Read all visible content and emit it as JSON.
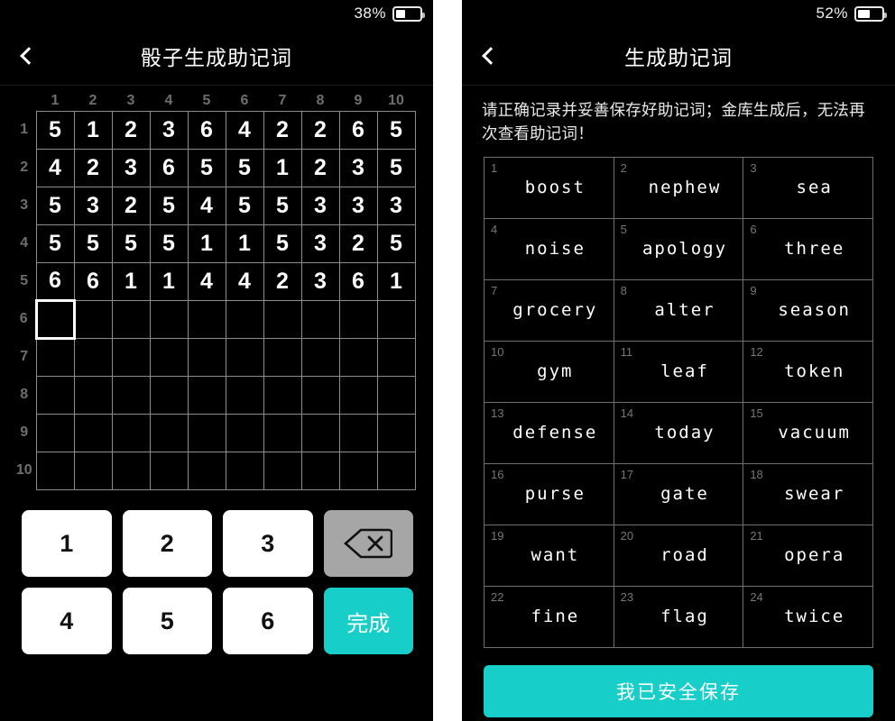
{
  "left_panel": {
    "status": {
      "battery_percent": "38%",
      "battery_level": 38
    },
    "header": {
      "back_icon": "chevron-left-icon",
      "title": "骰子生成助记词"
    },
    "dice_grid": {
      "column_headers": [
        "1",
        "2",
        "3",
        "4",
        "5",
        "6",
        "7",
        "8",
        "9",
        "10"
      ],
      "row_headers": [
        "1",
        "2",
        "3",
        "4",
        "5",
        "6",
        "7",
        "8",
        "9",
        "10"
      ],
      "rows": [
        [
          "5",
          "1",
          "2",
          "3",
          "6",
          "4",
          "2",
          "2",
          "6",
          "5"
        ],
        [
          "4",
          "2",
          "3",
          "6",
          "5",
          "5",
          "1",
          "2",
          "3",
          "5"
        ],
        [
          "5",
          "3",
          "2",
          "5",
          "4",
          "5",
          "5",
          "3",
          "3",
          "3"
        ],
        [
          "5",
          "5",
          "5",
          "5",
          "1",
          "1",
          "5",
          "3",
          "2",
          "5"
        ],
        [
          "6",
          "6",
          "1",
          "1",
          "4",
          "4",
          "2",
          "3",
          "6",
          "1"
        ],
        [
          "",
          "",
          "",
          "",
          "",
          "",
          "",
          "",
          "",
          ""
        ],
        [
          "",
          "",
          "",
          "",
          "",
          "",
          "",
          "",
          "",
          ""
        ],
        [
          "",
          "",
          "",
          "",
          "",
          "",
          "",
          "",
          "",
          ""
        ],
        [
          "",
          "",
          "",
          "",
          "",
          "",
          "",
          "",
          "",
          ""
        ],
        [
          "",
          "",
          "",
          "",
          "",
          "",
          "",
          "",
          "",
          ""
        ]
      ],
      "active_cell": {
        "row": 6,
        "col": 1
      }
    },
    "keypad": {
      "keys": [
        {
          "label": "1",
          "kind": "digit",
          "name": "key-1"
        },
        {
          "label": "2",
          "kind": "digit",
          "name": "key-2"
        },
        {
          "label": "3",
          "kind": "digit",
          "name": "key-3"
        },
        {
          "label": "⌫",
          "kind": "delete",
          "name": "backspace-key"
        },
        {
          "label": "4",
          "kind": "digit",
          "name": "key-4"
        },
        {
          "label": "5",
          "kind": "digit",
          "name": "key-5"
        },
        {
          "label": "6",
          "kind": "digit",
          "name": "key-6"
        },
        {
          "label": "完成",
          "kind": "done",
          "name": "done-key"
        }
      ]
    }
  },
  "right_panel": {
    "status": {
      "battery_percent": "52%",
      "battery_level": 52
    },
    "header": {
      "back_icon": "chevron-left-icon",
      "title": "生成助记词"
    },
    "warning": "请正确记录并妥善保存好助记词；金库生成后，无法再次查看助记词！",
    "mnemonic_words": [
      {
        "index": "1",
        "word": "boost"
      },
      {
        "index": "2",
        "word": "nephew"
      },
      {
        "index": "3",
        "word": "sea"
      },
      {
        "index": "4",
        "word": "noise"
      },
      {
        "index": "5",
        "word": "apology"
      },
      {
        "index": "6",
        "word": "three"
      },
      {
        "index": "7",
        "word": "grocery"
      },
      {
        "index": "8",
        "word": "alter"
      },
      {
        "index": "9",
        "word": "season"
      },
      {
        "index": "10",
        "word": "gym"
      },
      {
        "index": "11",
        "word": "leaf"
      },
      {
        "index": "12",
        "word": "token"
      },
      {
        "index": "13",
        "word": "defense"
      },
      {
        "index": "14",
        "word": "today"
      },
      {
        "index": "15",
        "word": "vacuum"
      },
      {
        "index": "16",
        "word": "purse"
      },
      {
        "index": "17",
        "word": "gate"
      },
      {
        "index": "18",
        "word": "swear"
      },
      {
        "index": "19",
        "word": "want"
      },
      {
        "index": "20",
        "word": "road"
      },
      {
        "index": "21",
        "word": "opera"
      },
      {
        "index": "22",
        "word": "fine"
      },
      {
        "index": "23",
        "word": "flag"
      },
      {
        "index": "24",
        "word": "twice"
      }
    ],
    "save_button_label": "我已安全保存"
  },
  "colors": {
    "accent_teal": "#17cfc8",
    "background": "#000000",
    "key_white": "#ffffff",
    "key_delete_grey": "#a6a6a6",
    "grid_line": "#8c8c8c"
  }
}
